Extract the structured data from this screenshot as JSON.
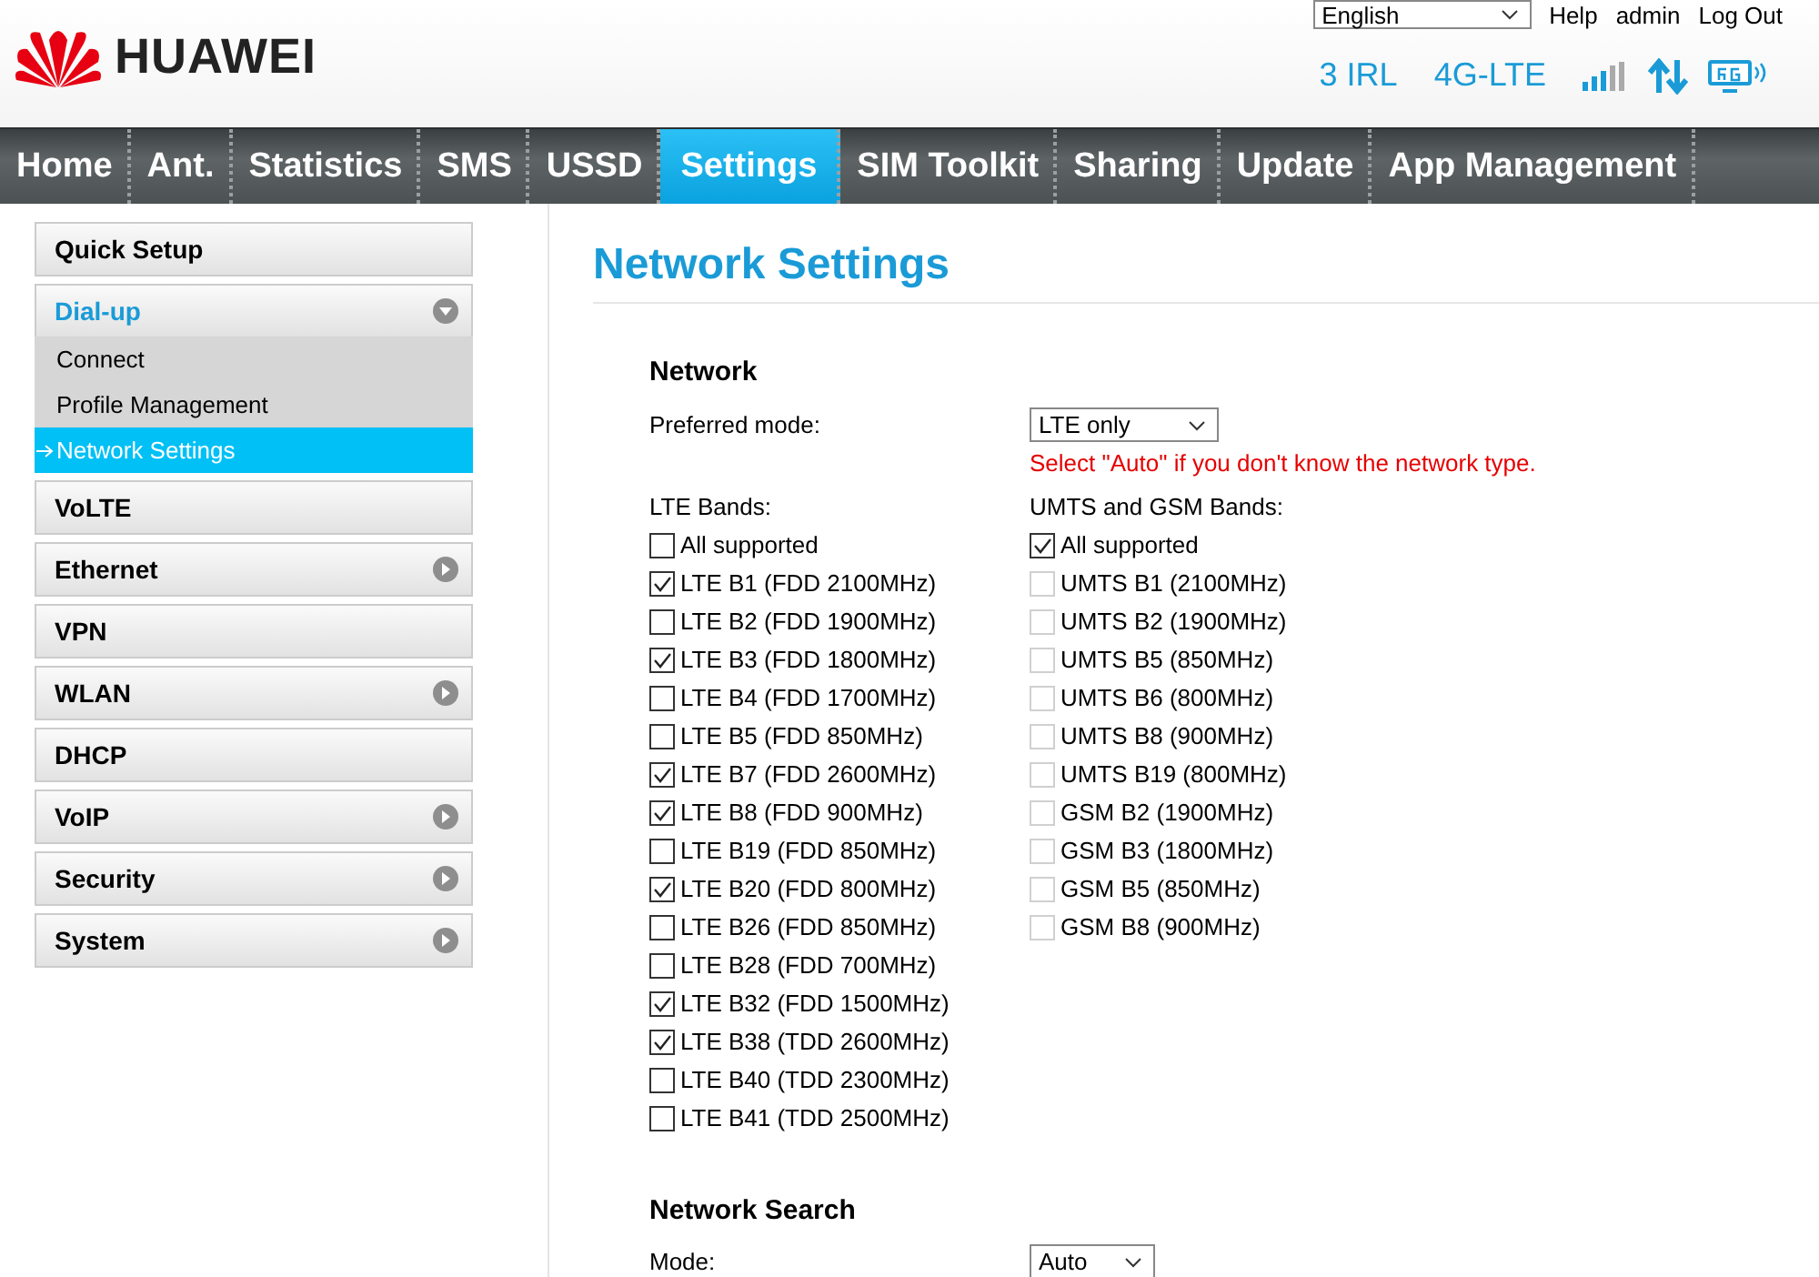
{
  "header": {
    "brand": "HUAWEI",
    "language": "English",
    "links": [
      "Help",
      "admin",
      "Log Out"
    ],
    "operator": "3 IRL",
    "network_type": "4G-LTE"
  },
  "nav": [
    {
      "label": "Home",
      "selected": false
    },
    {
      "label": "Ant.",
      "selected": false
    },
    {
      "label": "Statistics",
      "selected": false
    },
    {
      "label": "SMS",
      "selected": false
    },
    {
      "label": "USSD",
      "selected": false
    },
    {
      "label": "Settings",
      "selected": true
    },
    {
      "label": "SIM Toolkit",
      "selected": false
    },
    {
      "label": "Sharing",
      "selected": false
    },
    {
      "label": "Update",
      "selected": false
    },
    {
      "label": "App Management",
      "selected": false
    }
  ],
  "sidebar": {
    "items": [
      {
        "label": "Quick Setup",
        "expandable": false,
        "expanded": false
      },
      {
        "label": "Dial-up",
        "expandable": true,
        "expanded": true,
        "children": [
          {
            "label": "Connect",
            "selected": false
          },
          {
            "label": "Profile Management",
            "selected": false
          },
          {
            "label": "Network Settings",
            "selected": true
          }
        ]
      },
      {
        "label": "VoLTE",
        "expandable": false,
        "expanded": false
      },
      {
        "label": "Ethernet",
        "expandable": true,
        "expanded": false
      },
      {
        "label": "VPN",
        "expandable": false,
        "expanded": false
      },
      {
        "label": "WLAN",
        "expandable": true,
        "expanded": false
      },
      {
        "label": "DHCP",
        "expandable": false,
        "expanded": false
      },
      {
        "label": "VoIP",
        "expandable": true,
        "expanded": false
      },
      {
        "label": "Security",
        "expandable": true,
        "expanded": false
      },
      {
        "label": "System",
        "expandable": true,
        "expanded": false
      }
    ]
  },
  "page_title": "Network Settings",
  "network": {
    "heading": "Network",
    "preferred_mode_label": "Preferred mode:",
    "preferred_mode": "LTE only",
    "hint": "Select \"Auto\" if you don't know the network type.",
    "lte_label": "LTE Bands:",
    "lte_bands": [
      {
        "label": "All supported",
        "checked": false,
        "disabled": false
      },
      {
        "label": "LTE B1 (FDD 2100MHz)",
        "checked": true,
        "disabled": false
      },
      {
        "label": "LTE B2 (FDD 1900MHz)",
        "checked": false,
        "disabled": false
      },
      {
        "label": "LTE B3 (FDD 1800MHz)",
        "checked": true,
        "disabled": false
      },
      {
        "label": "LTE B4 (FDD 1700MHz)",
        "checked": false,
        "disabled": false
      },
      {
        "label": "LTE B5 (FDD 850MHz)",
        "checked": false,
        "disabled": false
      },
      {
        "label": "LTE B7 (FDD 2600MHz)",
        "checked": true,
        "disabled": false
      },
      {
        "label": "LTE B8 (FDD 900MHz)",
        "checked": true,
        "disabled": false
      },
      {
        "label": "LTE B19 (FDD 850MHz)",
        "checked": false,
        "disabled": false
      },
      {
        "label": "LTE B20 (FDD 800MHz)",
        "checked": true,
        "disabled": false
      },
      {
        "label": "LTE B26 (FDD 850MHz)",
        "checked": false,
        "disabled": false
      },
      {
        "label": "LTE B28 (FDD 700MHz)",
        "checked": false,
        "disabled": false
      },
      {
        "label": "LTE B32 (FDD 1500MHz)",
        "checked": true,
        "disabled": false
      },
      {
        "label": "LTE B38 (TDD 2600MHz)",
        "checked": true,
        "disabled": false
      },
      {
        "label": "LTE B40 (TDD 2300MHz)",
        "checked": false,
        "disabled": false
      },
      {
        "label": "LTE B41 (TDD 2500MHz)",
        "checked": false,
        "disabled": false
      }
    ],
    "umts_label": "UMTS and GSM Bands:",
    "umts_bands": [
      {
        "label": "All supported",
        "checked": true,
        "disabled": false
      },
      {
        "label": "UMTS B1 (2100MHz)",
        "checked": false,
        "disabled": true
      },
      {
        "label": "UMTS B2 (1900MHz)",
        "checked": false,
        "disabled": true
      },
      {
        "label": "UMTS B5 (850MHz)",
        "checked": false,
        "disabled": true
      },
      {
        "label": "UMTS B6 (800MHz)",
        "checked": false,
        "disabled": true
      },
      {
        "label": "UMTS B8 (900MHz)",
        "checked": false,
        "disabled": true
      },
      {
        "label": "UMTS B19 (800MHz)",
        "checked": false,
        "disabled": true
      },
      {
        "label": "GSM B2 (1900MHz)",
        "checked": false,
        "disabled": true
      },
      {
        "label": "GSM B3 (1800MHz)",
        "checked": false,
        "disabled": true
      },
      {
        "label": "GSM B5 (850MHz)",
        "checked": false,
        "disabled": true
      },
      {
        "label": "GSM B8 (900MHz)",
        "checked": false,
        "disabled": true
      }
    ]
  },
  "network_search": {
    "heading": "Network Search",
    "mode_label": "Mode:",
    "mode": "Auto"
  }
}
